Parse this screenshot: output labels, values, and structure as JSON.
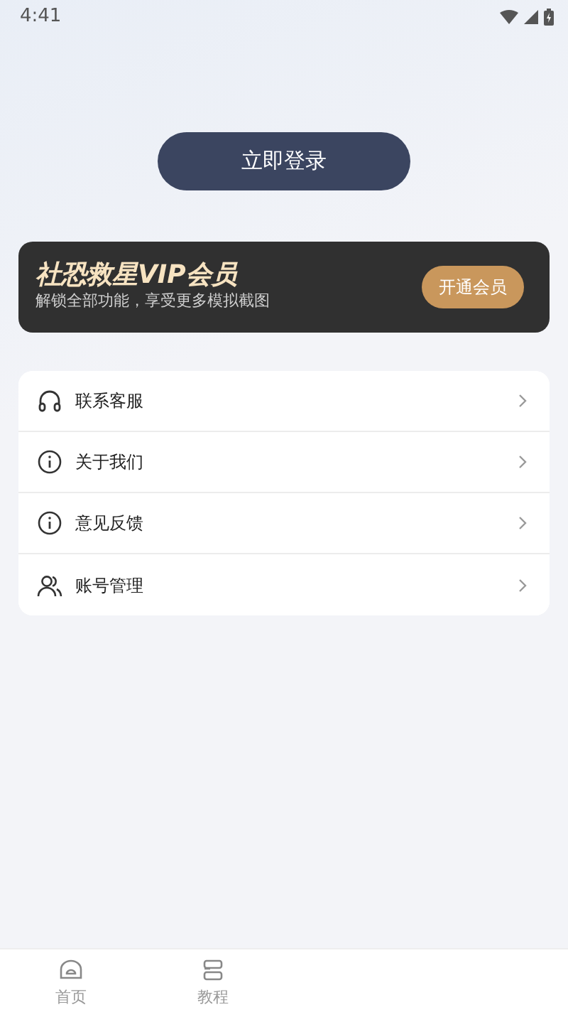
{
  "status_bar": {
    "time": "4:41"
  },
  "login_button": {
    "label": "立即登录"
  },
  "vip_banner": {
    "title": "社恐救星VIP会员",
    "subtitle": "解锁全部功能，享受更多模拟截图",
    "button": "开通会员"
  },
  "menu": [
    {
      "kind": "headset",
      "label": "联系客服"
    },
    {
      "kind": "info",
      "label": "关于我们"
    },
    {
      "kind": "info",
      "label": "意见反馈"
    },
    {
      "kind": "users",
      "label": "账号管理"
    }
  ],
  "tab_bar": [
    {
      "kind": "home",
      "label": "首页",
      "selected": false
    },
    {
      "kind": "tutorial",
      "label": "教程",
      "selected": false
    }
  ]
}
